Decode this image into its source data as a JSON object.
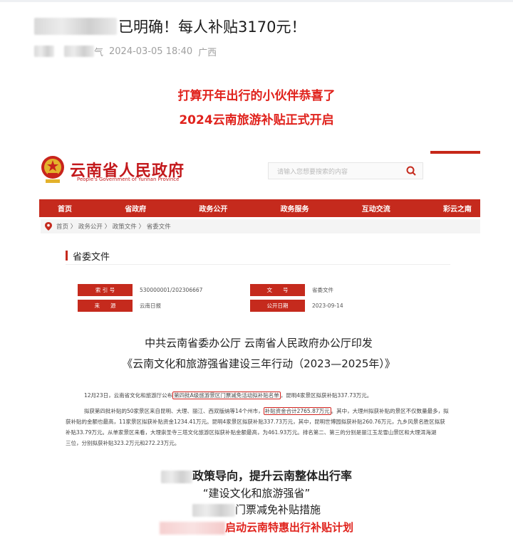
{
  "article": {
    "title": "已明确！每人补贴3170元！",
    "date": "2024-03-05 18:40",
    "region": "广西",
    "meta_suffix": "气",
    "headline_1": "打算开年出行的小伙伴恭喜了",
    "headline_2": "2024云南旅游补贴正式开启"
  },
  "screenshot": {
    "site_name": "云南省人民政府",
    "site_name_en": "People's Government of Yunnan Province",
    "search_placeholder": "请输入您想要搜索的内容",
    "nav": [
      "首页",
      "省政府",
      "政务公开",
      "政务服务",
      "互动交流",
      "彩云之南"
    ],
    "breadcrumb": "首页 〉 政务公开 〉 政策文件 〉 省委文件",
    "section_title": "省委文件",
    "doc_meta": {
      "index_label": "索 引 号",
      "index_value": "530000001/202306667",
      "docno_label": "文　　号",
      "docno_value": "省委文件",
      "source_label": "来　　源",
      "source_value": "云南日报",
      "date_label": "公开日期",
      "date_value": "2023-09-14"
    },
    "doc_title_1": "中共云南省委办公厅 云南省人民政府办公厅印发",
    "doc_title_2": "《云南文化和旅游强省建设三年行动（2023—2025年）》"
  },
  "body": {
    "p1_a": "12月23日，云南省文化和旅游厅公布",
    "p1_box": "第四批A级旅游景区门票减免活动拟补贴名单",
    "p1_b": "，昆明4家景区拟获补贴337.73万元。",
    "p2_a": "拟获第四批补贴的50家景区来自昆明、大理、丽江、西双版纳等14个州市，",
    "p2_box": "补贴资金合计2765.87万元",
    "p2_b": "。其中，大理州拟获补贴的景区不仅数量最多，拟",
    "p3": "获补贴的金额也最高，11家景区拟获补贴资金1234.41万元。昆明4家景区拟获补贴337.73万元，其中，昆明世博园拟获补贴260.76万元，九乡风景名胜区拟获",
    "p4": "补贴33.79万元。从单家景区来看，大理崇圣寺三塔文化旅游区拟获补贴金额最高，为461.93万元。排名第二、第三的分别是丽江玉龙雪山景区和大理洱海湖",
    "p5": "三位，分别拟获补贴323.2万元和272.23万元。"
  },
  "bottom": {
    "line1": "政策导向，提升云南整体出行率",
    "line2": "“建设文化和旅游强省”",
    "line3": "门票减免补贴措施",
    "line4": "启动云南特惠出行补贴计划"
  },
  "colors": {
    "accent_red": "#e0221c",
    "gov_red": "#c52a1d"
  }
}
